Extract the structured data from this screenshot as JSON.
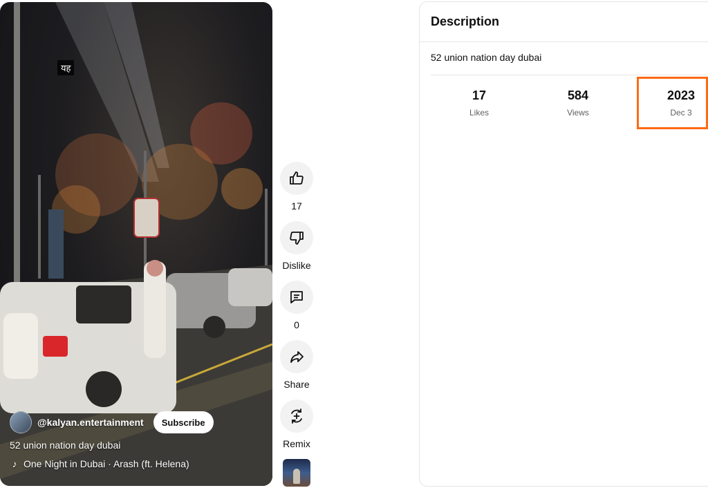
{
  "video": {
    "overlay_text": "यह",
    "channel_name": "@kalyan.entertainment",
    "subscribe_label": "Subscribe",
    "title": "52 union nation day dubai",
    "music": "One Night in Dubai · Arash (ft. Helena)",
    "music_icon": "music-note-icon"
  },
  "actions": {
    "like_count": "17",
    "dislike_label": "Dislike",
    "comment_count": "0",
    "share_label": "Share",
    "remix_label": "Remix"
  },
  "description": {
    "title": "Description",
    "text": "52 union nation day dubai",
    "stats": [
      {
        "value": "17",
        "label": "Likes"
      },
      {
        "value": "584",
        "label": "Views"
      },
      {
        "value": "2023",
        "label": "Dec 3"
      }
    ],
    "highlight_color": "#ff6a13"
  }
}
